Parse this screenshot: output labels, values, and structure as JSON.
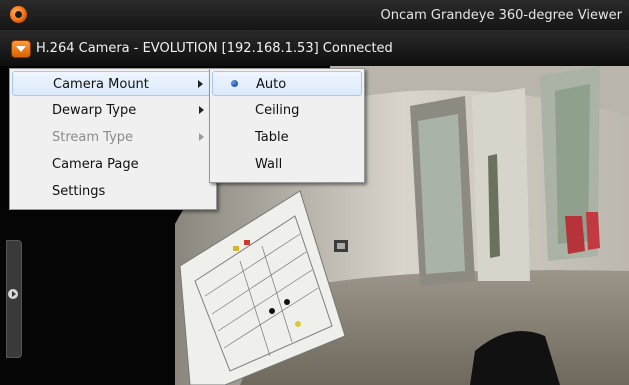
{
  "window": {
    "title": "Oncam Grandeye 360-degree Viewer",
    "accent_color": "#ff7a1a"
  },
  "camera": {
    "status_text": "H.264 Camera - EVOLUTION [192.168.1.53] Connected"
  },
  "context_menu": {
    "items": [
      {
        "label": "Camera Mount",
        "has_submenu": true,
        "highlighted": true
      },
      {
        "label": "Dewarp Type",
        "has_submenu": true
      },
      {
        "label": "Stream Type",
        "has_submenu": true,
        "disabled": true
      },
      {
        "label": "Camera Page"
      },
      {
        "label": "Settings"
      }
    ]
  },
  "mount_submenu": {
    "selected": "Auto",
    "items": [
      {
        "label": "Auto"
      },
      {
        "label": "Ceiling"
      },
      {
        "label": "Table"
      },
      {
        "label": "Wall"
      }
    ]
  }
}
